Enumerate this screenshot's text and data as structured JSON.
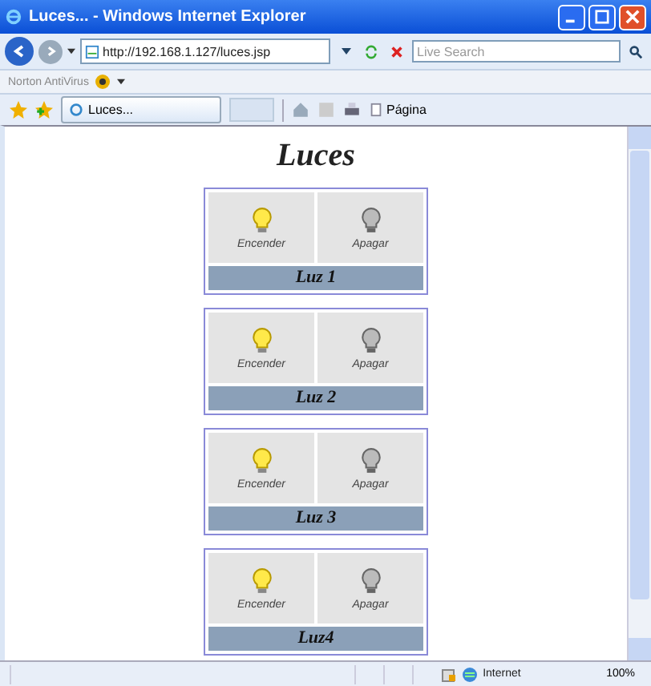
{
  "window": {
    "title": "Luces... - Windows Internet Explorer"
  },
  "address_bar": {
    "url": "http://192.168.1.127/luces.jsp",
    "search_placeholder": "Live Search"
  },
  "norton_bar": {
    "label": "Norton AntiVirus"
  },
  "favorites_bar": {
    "tab": "Luces...",
    "page_menu": "Página"
  },
  "page": {
    "heading": "Luces",
    "lights": [
      {
        "name": "Luz 1",
        "on_label": "Encender",
        "off_label": "Apagar"
      },
      {
        "name": "Luz 2",
        "on_label": "Encender",
        "off_label": "Apagar"
      },
      {
        "name": "Luz 3",
        "on_label": "Encender",
        "off_label": "Apagar"
      },
      {
        "name": "Luz4",
        "on_label": "Encender",
        "off_label": "Apagar"
      }
    ]
  },
  "status_bar": {
    "zone": "Internet",
    "zoom": "100%"
  }
}
